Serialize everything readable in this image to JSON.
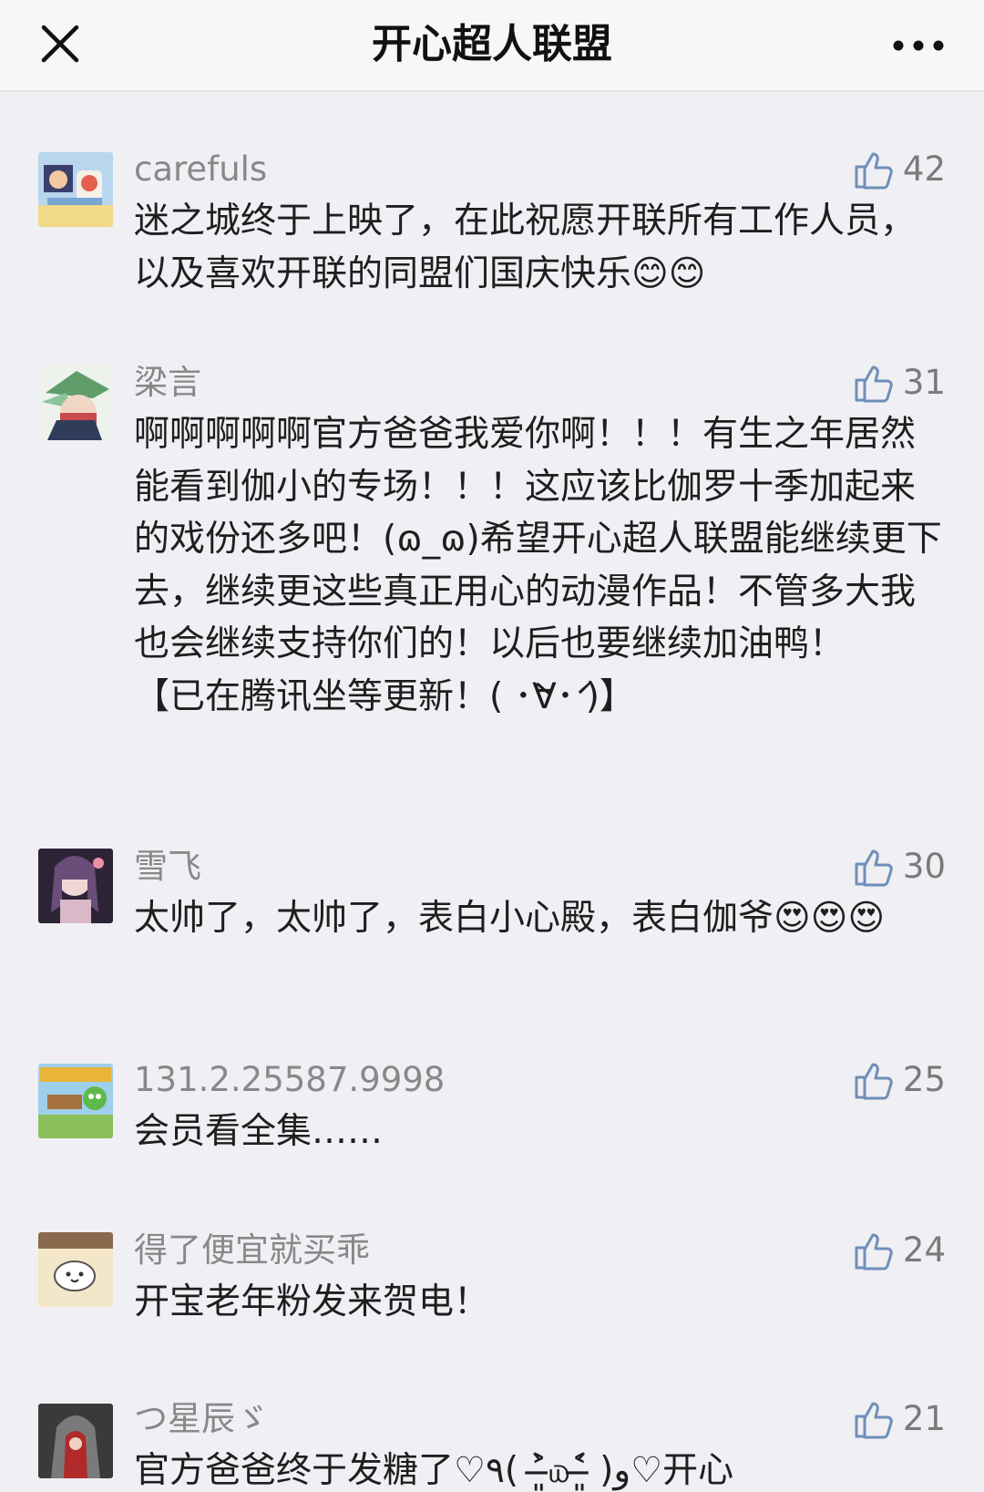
{
  "nav": {
    "title": "开心超人联盟",
    "close_icon": "close-icon",
    "more_icon": "more-icon"
  },
  "colors": {
    "background": "#efeff4",
    "navbar": "#f7f7f7",
    "name_gray": "#888888",
    "text": "#1e1e1e"
  },
  "comments": [
    {
      "name": "carefuls",
      "likes": "42",
      "text": "迷之城终于上映了，在此祝愿开联所有工作人员，以及喜欢开联的同盟们国庆快乐😊😊"
    },
    {
      "name": "梁言",
      "likes": "31",
      "text": "啊啊啊啊啊官方爸爸我爱你啊！！！有生之年居然能看到伽小的专场！！！这应该比伽罗十季加起来的戏份还多吧！(ɷ_ɷ)希望开心超人联盟能继续更下去，继续更这些真正用心的动漫作品！不管多大我也会继续支持你们的！以后也要继续加油鸭！\n【已在腾讯坐等更新！( ･̀∀･́ )】"
    },
    {
      "name": "雪飞",
      "likes": "30",
      "text": "太帅了，太帅了，表白小心殿，表白伽爷😍😍😍"
    },
    {
      "name": "131.2.25587.9998",
      "likes": "25",
      "text": "会员看全集……"
    },
    {
      "name": "得了便宜就买乖",
      "likes": "24",
      "text": "开宝老年粉发来贺电！"
    },
    {
      "name": "つ星辰ゞ",
      "likes": "21",
      "text": "官方爸爸终于发糖了♡٩( ˃̶͈̀௰˂̶͈́ )و♡开心"
    }
  ]
}
